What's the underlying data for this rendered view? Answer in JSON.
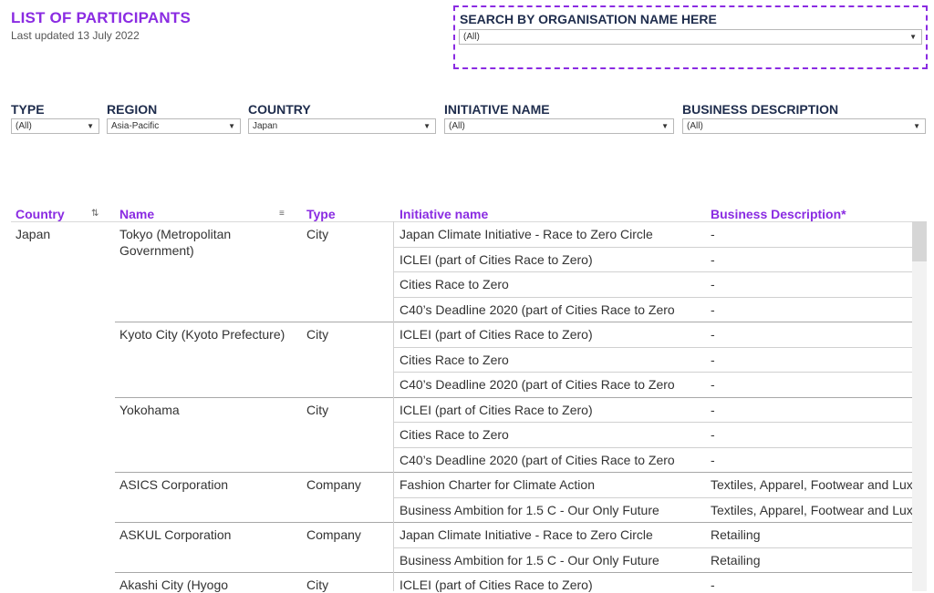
{
  "header": {
    "title": "LIST OF PARTICIPANTS",
    "subtitle": "Last updated 13 July 2022",
    "search_label": "SEARCH BY ORGANISATION NAME HERE",
    "search_value": "(All)"
  },
  "filters": [
    {
      "label": "TYPE",
      "value": "(All)"
    },
    {
      "label": "REGION",
      "value": "Asia-Pacific"
    },
    {
      "label": "COUNTRY",
      "value": "Japan"
    },
    {
      "label": "INITIATIVE NAME",
      "value": "(All)"
    },
    {
      "label": "BUSINESS DESCRIPTION",
      "value": "(All)"
    }
  ],
  "table": {
    "columns": [
      "Country",
      "Name",
      "Type",
      "Initiative name",
      "Business Description*"
    ],
    "country": "Japan",
    "orgs": [
      {
        "name": "Tokyo (Metropolitan Government)",
        "type": "City"
      },
      {
        "name": "Kyoto City (Kyoto Prefecture)",
        "type": "City"
      },
      {
        "name": "Yokohama",
        "type": "City"
      },
      {
        "name": "ASICS Corporation",
        "type": "Company"
      },
      {
        "name": "ASKUL Corporation",
        "type": "Company"
      },
      {
        "name": "Akashi City (Hyogo",
        "type": "City"
      }
    ],
    "rows": [
      {
        "initiative": "Japan Climate Initiative - Race to Zero Circle",
        "business": "-"
      },
      {
        "initiative": "ICLEI (part of Cities Race to Zero)",
        "business": "-"
      },
      {
        "initiative": "Cities Race to Zero",
        "business": "-"
      },
      {
        "initiative": "C40’s Deadline 2020 (part of Cities Race to Zero",
        "business": "-"
      },
      {
        "initiative": "ICLEI (part of Cities Race to Zero)",
        "business": "-"
      },
      {
        "initiative": "Cities Race to Zero",
        "business": "-"
      },
      {
        "initiative": "C40’s Deadline 2020 (part of Cities Race to Zero",
        "business": "-"
      },
      {
        "initiative": "ICLEI (part of Cities Race to Zero)",
        "business": "-"
      },
      {
        "initiative": "Cities Race to Zero",
        "business": "-"
      },
      {
        "initiative": "C40’s Deadline 2020 (part of Cities Race to Zero",
        "business": "-"
      },
      {
        "initiative": "Fashion Charter for Climate Action",
        "business": "Textiles, Apparel, Footwear and Luxury Goods"
      },
      {
        "initiative": "Business Ambition for 1.5 C - Our Only Future",
        "business": "Textiles, Apparel, Footwear and Luxury Goods"
      },
      {
        "initiative": "Japan Climate Initiative - Race to Zero Circle",
        "business": "Retailing"
      },
      {
        "initiative": "Business Ambition for 1.5 C - Our Only Future",
        "business": "Retailing"
      },
      {
        "initiative": "ICLEI (part of Cities Race to Zero)",
        "business": "-"
      }
    ]
  },
  "icons": {
    "dropdown": "caret-down-icon",
    "sort_alpha": "sort-alpha-icon",
    "sort_desc": "sort-desc-icon"
  },
  "colors": {
    "accent": "#8a2be2",
    "label": "#1f2d4d"
  }
}
